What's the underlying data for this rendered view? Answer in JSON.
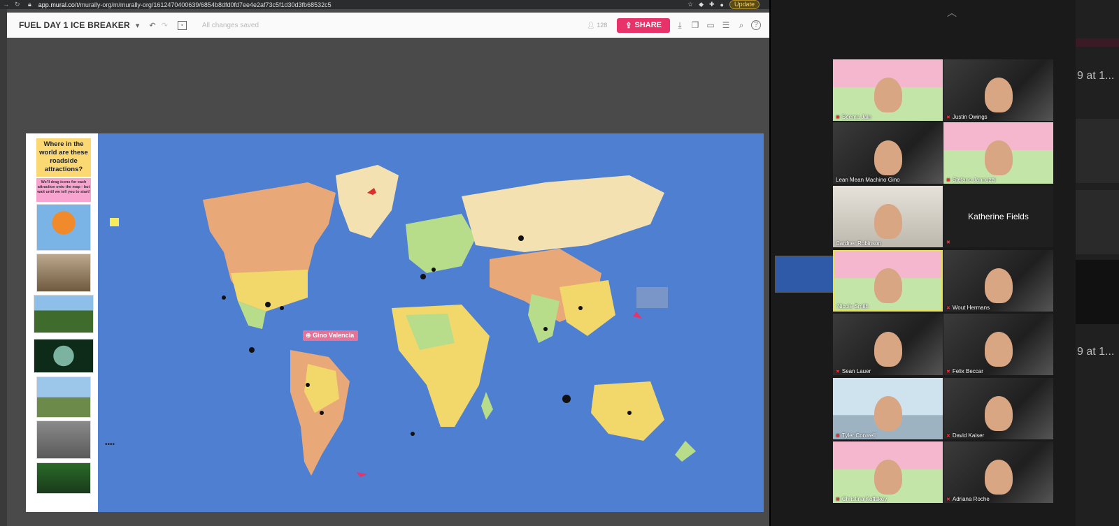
{
  "browser": {
    "url_host": "app.mural.co",
    "url_path": "/t/murally-org/m/murally-org/1612470400639/6854b8dfd0fd7ee4e2af73c5f1d30d3fb68532c5",
    "update_label": "Update"
  },
  "mural": {
    "title": "FUEL DAY 1 ICE BREAKER",
    "saved_status": "All changes saved",
    "member_count": "128",
    "share_label": "SHARE",
    "help_label": "?",
    "question_text": "Where in the world are these roadside attractions?",
    "instruction_text": "We'll drag icons for each attraction onto the map - but wait until we tell you to start!",
    "cursor_label": "Gino Valencia",
    "more_label": "••••"
  },
  "zoom": {
    "participants": [
      {
        "name": "Seema Jain"
      },
      {
        "name": "Justin Owings"
      },
      {
        "name": "Lean Mean Machino Gino"
      },
      {
        "name": "Stefano Jannuzzi"
      },
      {
        "name": "Cardner Robinson"
      },
      {
        "name": "Katherine Fields"
      },
      {
        "name": "Nicole Smith"
      },
      {
        "name": "Wout Hermans"
      },
      {
        "name": "Sean Lauer"
      },
      {
        "name": "Felix Beccar"
      },
      {
        "name": "Tyler Conwell"
      },
      {
        "name": "David Kaiser"
      },
      {
        "name": "Christina Koffskey"
      },
      {
        "name": "Adriana Roche"
      }
    ]
  },
  "strip": {
    "text1": "9 at 1...",
    "text2": "9 at 1..."
  }
}
